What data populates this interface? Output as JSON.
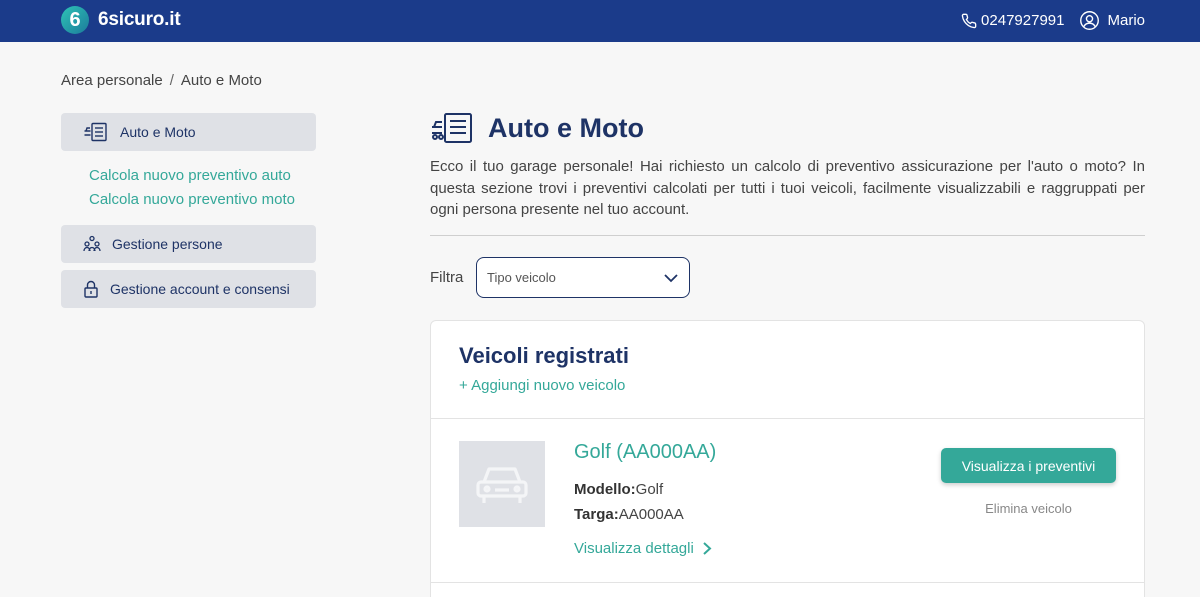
{
  "header": {
    "logo_digit": "6",
    "logo_text": "6sicuro.it",
    "phone": "0247927991",
    "user_name": "Mario",
    "bg_color": "#1b3b8a"
  },
  "breadcrumb": {
    "root": "Area personale",
    "separator": "/",
    "current": "Auto e Moto"
  },
  "sidebar": {
    "items": [
      {
        "label": "Auto e Moto",
        "icon": "car-doc-icon"
      },
      {
        "label": "Gestione persone",
        "icon": "people-icon"
      },
      {
        "label": "Gestione account e consensi",
        "icon": "lock-icon"
      }
    ],
    "sub_links": [
      "Calcola nuovo preventivo auto",
      "Calcola nuovo preventivo moto"
    ]
  },
  "main": {
    "title": "Auto e Moto",
    "intro": "Ecco il tuo garage personale! Hai richiesto un calcolo di preventivo assicurazione per l'auto o moto? In questa sezione trovi i preventivi calcolati per tutti i tuoi veicoli, facilmente visualizzabili e raggruppati per ogni persona presente nel tuo account.",
    "filter_label": "Filtra",
    "filter_placeholder": "Tipo veicolo"
  },
  "card": {
    "title": "Veicoli registrati",
    "add_link": "+ Aggiungi nuovo veicolo",
    "vehicle": {
      "title": "Golf (AA000AA)",
      "model_label": "Modello:",
      "model_value": "Golf",
      "plate_label": "Targa:",
      "plate_value": "AA000AA",
      "details_link": "Visualizza dettagli",
      "view_button": "Visualizza i preventivi",
      "delete_link": "Elimina veicolo"
    }
  },
  "colors": {
    "accent": "#34a899",
    "navy": "#1e3366",
    "sidebar_bg": "#dfe1e6"
  }
}
